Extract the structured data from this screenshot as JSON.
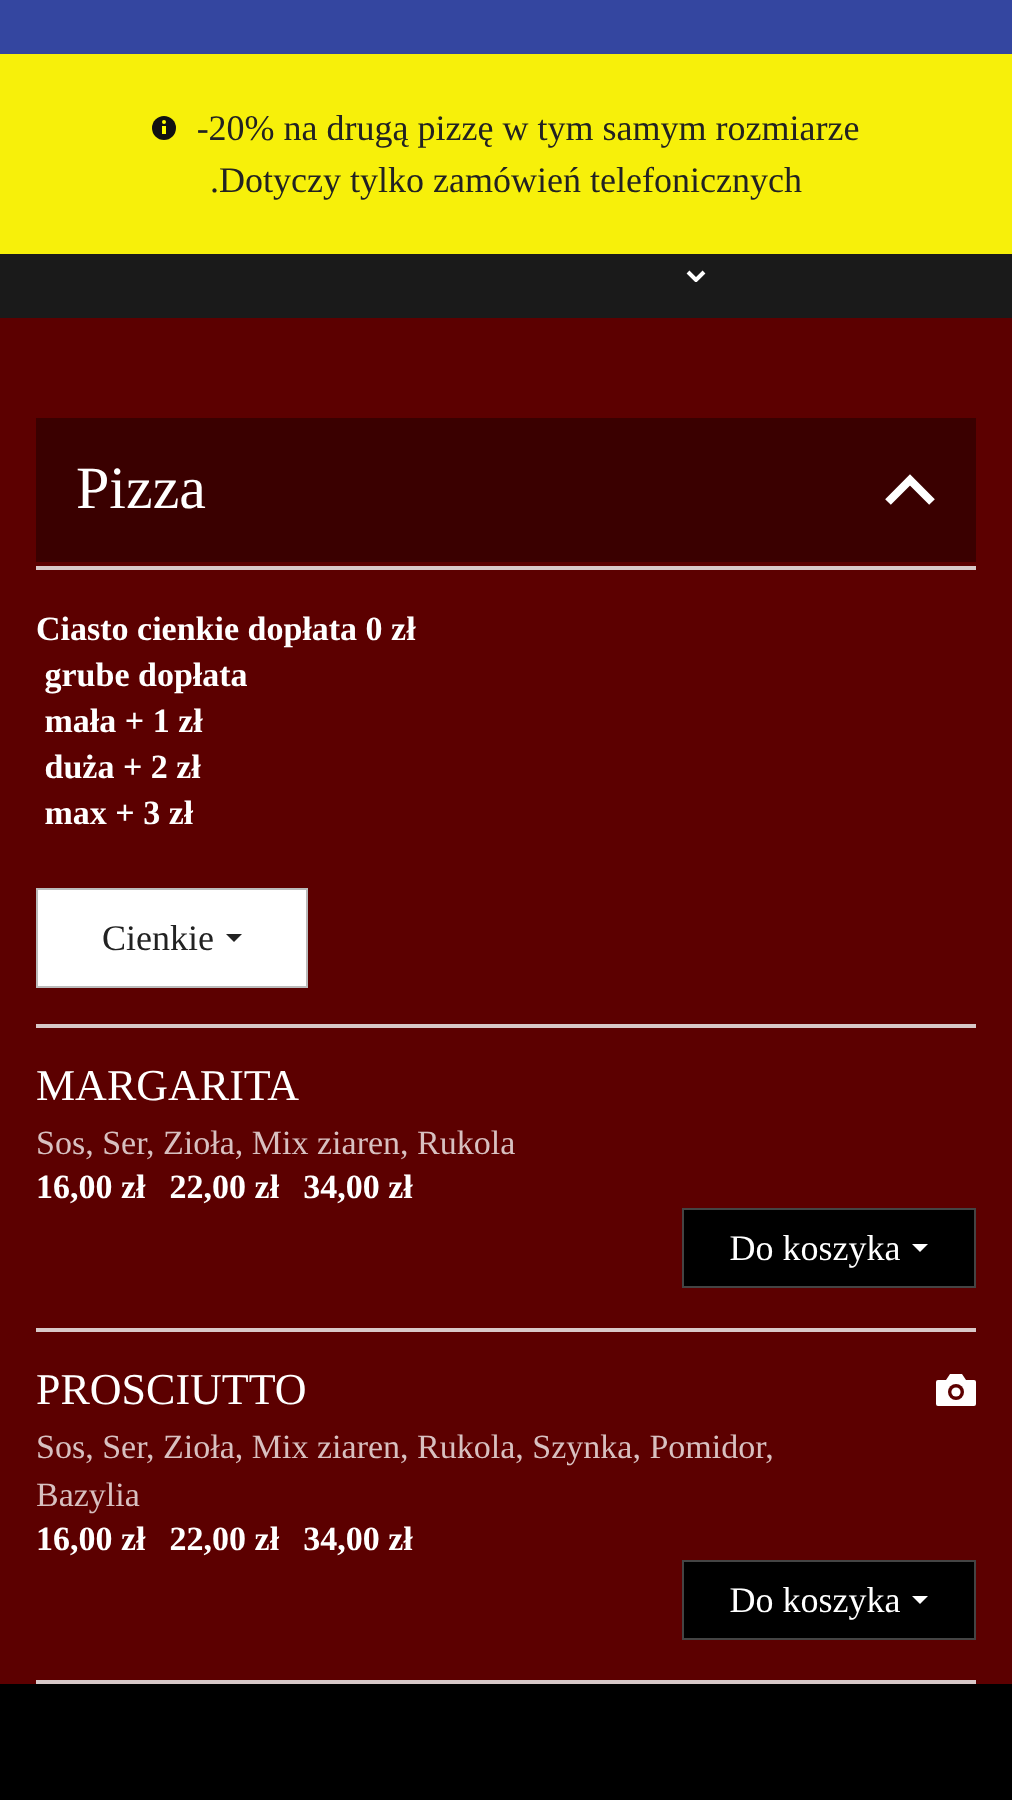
{
  "promo_banner": {
    "lines": [
      "-20% na drugą pizzę w tym samym rozmiarze",
      ".Dotyczy tylko zamówień telefonicznych"
    ]
  },
  "category": {
    "title": "Pizza",
    "expanded": true,
    "description": [
      "Ciasto cienkie dopłata 0 zł",
      " grube dopłata",
      " mała + 1 zł",
      " duża + 2 zł",
      " max + 3 zł"
    ],
    "dough_select": {
      "value": "Cienkie"
    },
    "items": [
      {
        "name": "MARGARITA",
        "has_photo": false,
        "ingredients": "Sos, Ser, Zioła, Mix ziaren, Rukola",
        "prices": [
          "16,00 zł",
          "22,00 zł",
          "34,00 zł"
        ],
        "button": "Do koszyka"
      },
      {
        "name": "PROSCIUTTO",
        "has_photo": true,
        "ingredients": "Sos, Ser, Zioła, Mix ziaren, Rukola, Szynka, Pomidor, Bazylia",
        "prices": [
          "16,00 zł",
          "22,00 zł",
          "34,00 zł"
        ],
        "button": "Do koszyka"
      }
    ]
  }
}
